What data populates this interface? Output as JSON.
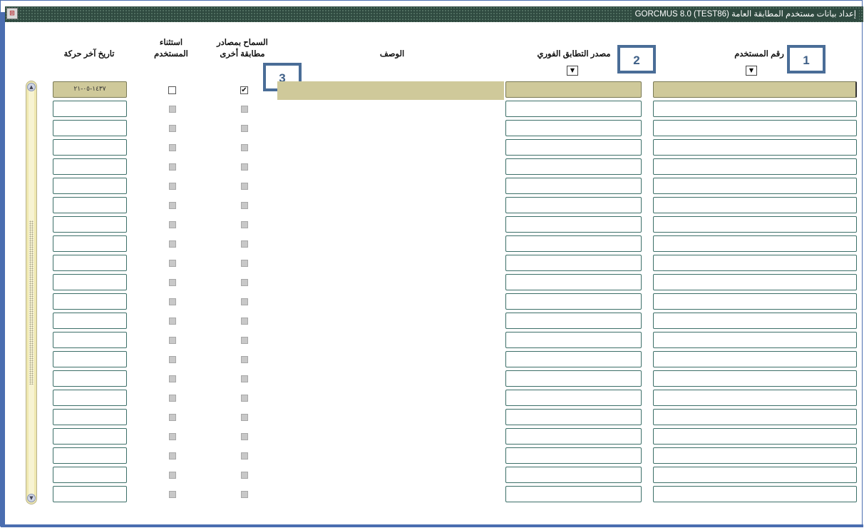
{
  "window": {
    "title": "إعداد بيانات مستخدم المطابقة العامة  GORCMUS  8.0  (TEST86)",
    "icon": "app-icon"
  },
  "columns": {
    "user_id": "رقم المستخدم",
    "instant_source": "مصدر التطابق الفوري",
    "description": "الوصف",
    "allow_other_sources_line1": "السماح بمصادر",
    "allow_other_sources_line2": "مطابقة أخرى",
    "user_exception_line1": "استثناء",
    "user_exception_line2": "المستخدم",
    "last_activity_date": "تاريخ آخر حركة"
  },
  "callouts": [
    "1",
    "2",
    "3"
  ],
  "rows": [
    {
      "user_id": "",
      "source": "",
      "description": "",
      "allow_other": true,
      "exception": false,
      "last_activity": "١٤٣٧-٠٥-٢١"
    },
    {
      "user_id": "",
      "source": "",
      "description": "",
      "allow_other": false,
      "exception": false,
      "last_activity": ""
    },
    {
      "user_id": "",
      "source": "",
      "description": "",
      "allow_other": false,
      "exception": false,
      "last_activity": ""
    },
    {
      "user_id": "",
      "source": "",
      "description": "",
      "allow_other": false,
      "exception": false,
      "last_activity": ""
    },
    {
      "user_id": "",
      "source": "",
      "description": "",
      "allow_other": false,
      "exception": false,
      "last_activity": ""
    },
    {
      "user_id": "",
      "source": "",
      "description": "",
      "allow_other": false,
      "exception": false,
      "last_activity": ""
    },
    {
      "user_id": "",
      "source": "",
      "description": "",
      "allow_other": false,
      "exception": false,
      "last_activity": ""
    },
    {
      "user_id": "",
      "source": "",
      "description": "",
      "allow_other": false,
      "exception": false,
      "last_activity": ""
    },
    {
      "user_id": "",
      "source": "",
      "description": "",
      "allow_other": false,
      "exception": false,
      "last_activity": ""
    },
    {
      "user_id": "",
      "source": "",
      "description": "",
      "allow_other": false,
      "exception": false,
      "last_activity": ""
    },
    {
      "user_id": "",
      "source": "",
      "description": "",
      "allow_other": false,
      "exception": false,
      "last_activity": ""
    },
    {
      "user_id": "",
      "source": "",
      "description": "",
      "allow_other": false,
      "exception": false,
      "last_activity": ""
    },
    {
      "user_id": "",
      "source": "",
      "description": "",
      "allow_other": false,
      "exception": false,
      "last_activity": ""
    },
    {
      "user_id": "",
      "source": "",
      "description": "",
      "allow_other": false,
      "exception": false,
      "last_activity": ""
    },
    {
      "user_id": "",
      "source": "",
      "description": "",
      "allow_other": false,
      "exception": false,
      "last_activity": ""
    },
    {
      "user_id": "",
      "source": "",
      "description": "",
      "allow_other": false,
      "exception": false,
      "last_activity": ""
    },
    {
      "user_id": "",
      "source": "",
      "description": "",
      "allow_other": false,
      "exception": false,
      "last_activity": ""
    },
    {
      "user_id": "",
      "source": "",
      "description": "",
      "allow_other": false,
      "exception": false,
      "last_activity": ""
    },
    {
      "user_id": "",
      "source": "",
      "description": "",
      "allow_other": false,
      "exception": false,
      "last_activity": ""
    },
    {
      "user_id": "",
      "source": "",
      "description": "",
      "allow_other": false,
      "exception": false,
      "last_activity": ""
    },
    {
      "user_id": "",
      "source": "",
      "description": "",
      "allow_other": false,
      "exception": false,
      "last_activity": ""
    },
    {
      "user_id": "",
      "source": "",
      "description": "",
      "allow_other": false,
      "exception": false,
      "last_activity": ""
    }
  ]
}
